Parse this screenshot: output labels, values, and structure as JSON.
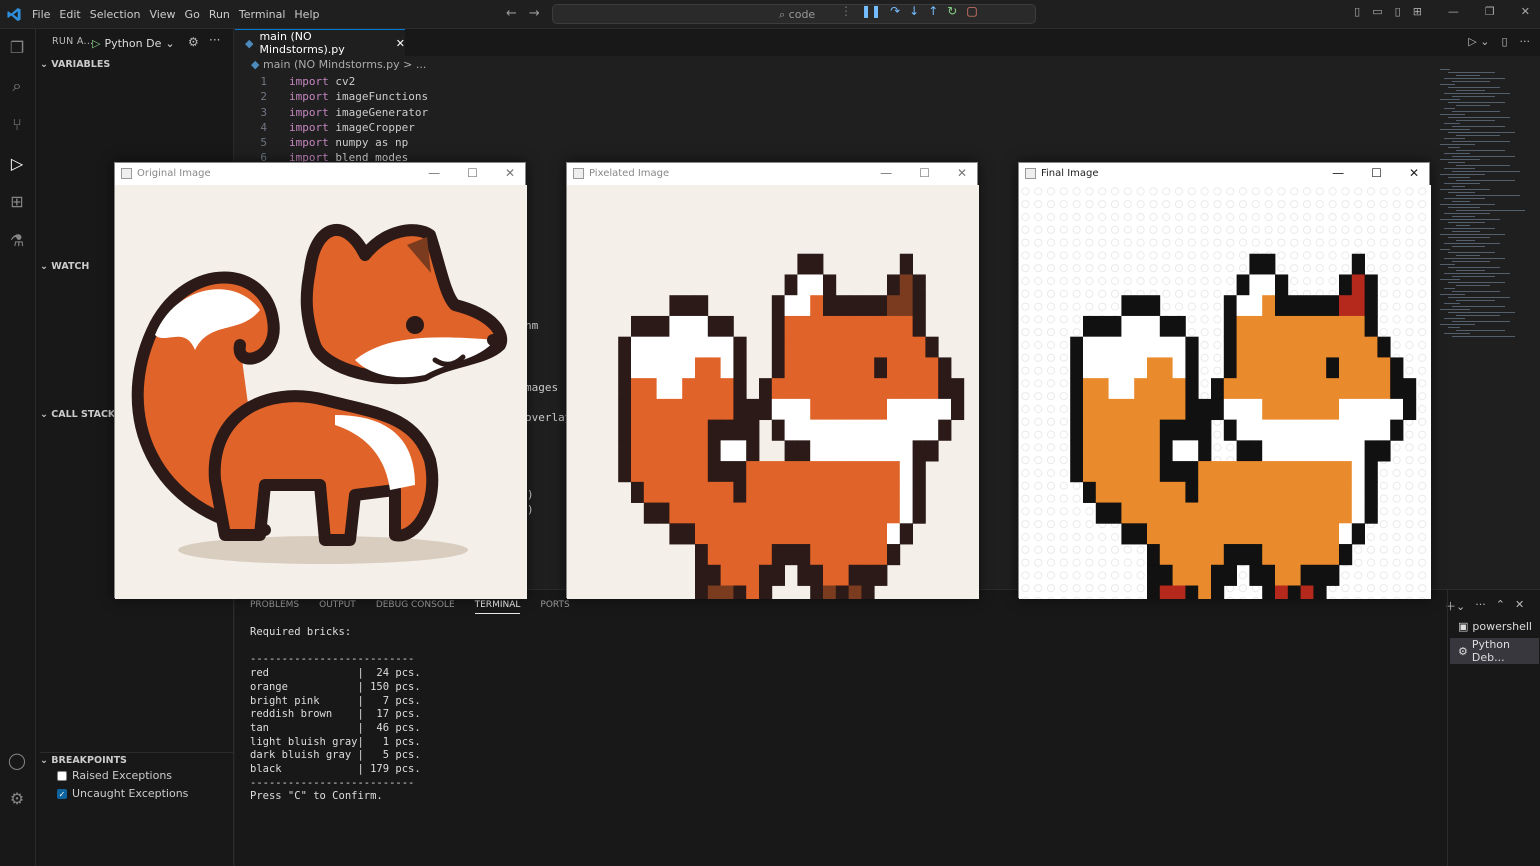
{
  "menu": [
    "File",
    "Edit",
    "Selection",
    "View",
    "Go",
    "Run",
    "Terminal",
    "Help"
  ],
  "search": {
    "text": "code"
  },
  "sidebar": {
    "header": "RUN A...",
    "config": "Python De",
    "sections": {
      "variables": "VARIABLES",
      "watch": "WATCH",
      "callstack": "CALL STACK",
      "breakpoints": "BREAKPOINTS"
    },
    "breakpoints": [
      {
        "label": "Raised Exceptions",
        "checked": false
      },
      {
        "label": "Uncaught Exceptions",
        "checked": true
      }
    ]
  },
  "editor": {
    "tab": "main (NO Mindstorms).py",
    "breadcrumb": "main (NO Mindstorms.py > ...",
    "lines": [
      {
        "n": "1",
        "kw": "import",
        "rest": " cv2"
      },
      {
        "n": "2",
        "kw": "import",
        "rest": " imageFunctions"
      },
      {
        "n": "3",
        "kw": "import",
        "rest": " imageGenerator"
      },
      {
        "n": "4",
        "kw": "import",
        "rest": " imageCropper"
      },
      {
        "n": "5",
        "kw": "import",
        "rest": " numpy as np"
      },
      {
        "n": "6",
        "kw": "import",
        "rest": " blend_modes"
      }
    ],
    "fragments": [
      "nm",
      "mages",
      "overlay",
      ")",
      ")"
    ]
  },
  "panel": {
    "tabs": [
      "PROBLEMS",
      "OUTPUT",
      "DEBUG CONSOLE",
      "TERMINAL",
      "PORTS"
    ],
    "active": "TERMINAL",
    "terminal": "Required bricks:\n\n--------------------------\nred              |  24 pcs.\norange           | 150 pcs.\nbright pink      |   7 pcs.\nreddish brown    |  17 pcs.\ntan              |  46 pcs.\nlight bluish gray|   1 pcs.\ndark bluish gray |   5 pcs.\nblack            | 179 pcs.\n--------------------------\nPress \"C\" to Confirm.",
    "terminals": [
      "powershell",
      "Python Deb..."
    ]
  },
  "windows": [
    {
      "title": "Original Image"
    },
    {
      "title": "Pixelated Image"
    },
    {
      "title": "Final Image"
    }
  ],
  "colors": {
    "accent": "#0078d4",
    "fox_orange": "#e0632a",
    "lego_orange": "#e98a2c",
    "dark": "#2b1a17"
  }
}
